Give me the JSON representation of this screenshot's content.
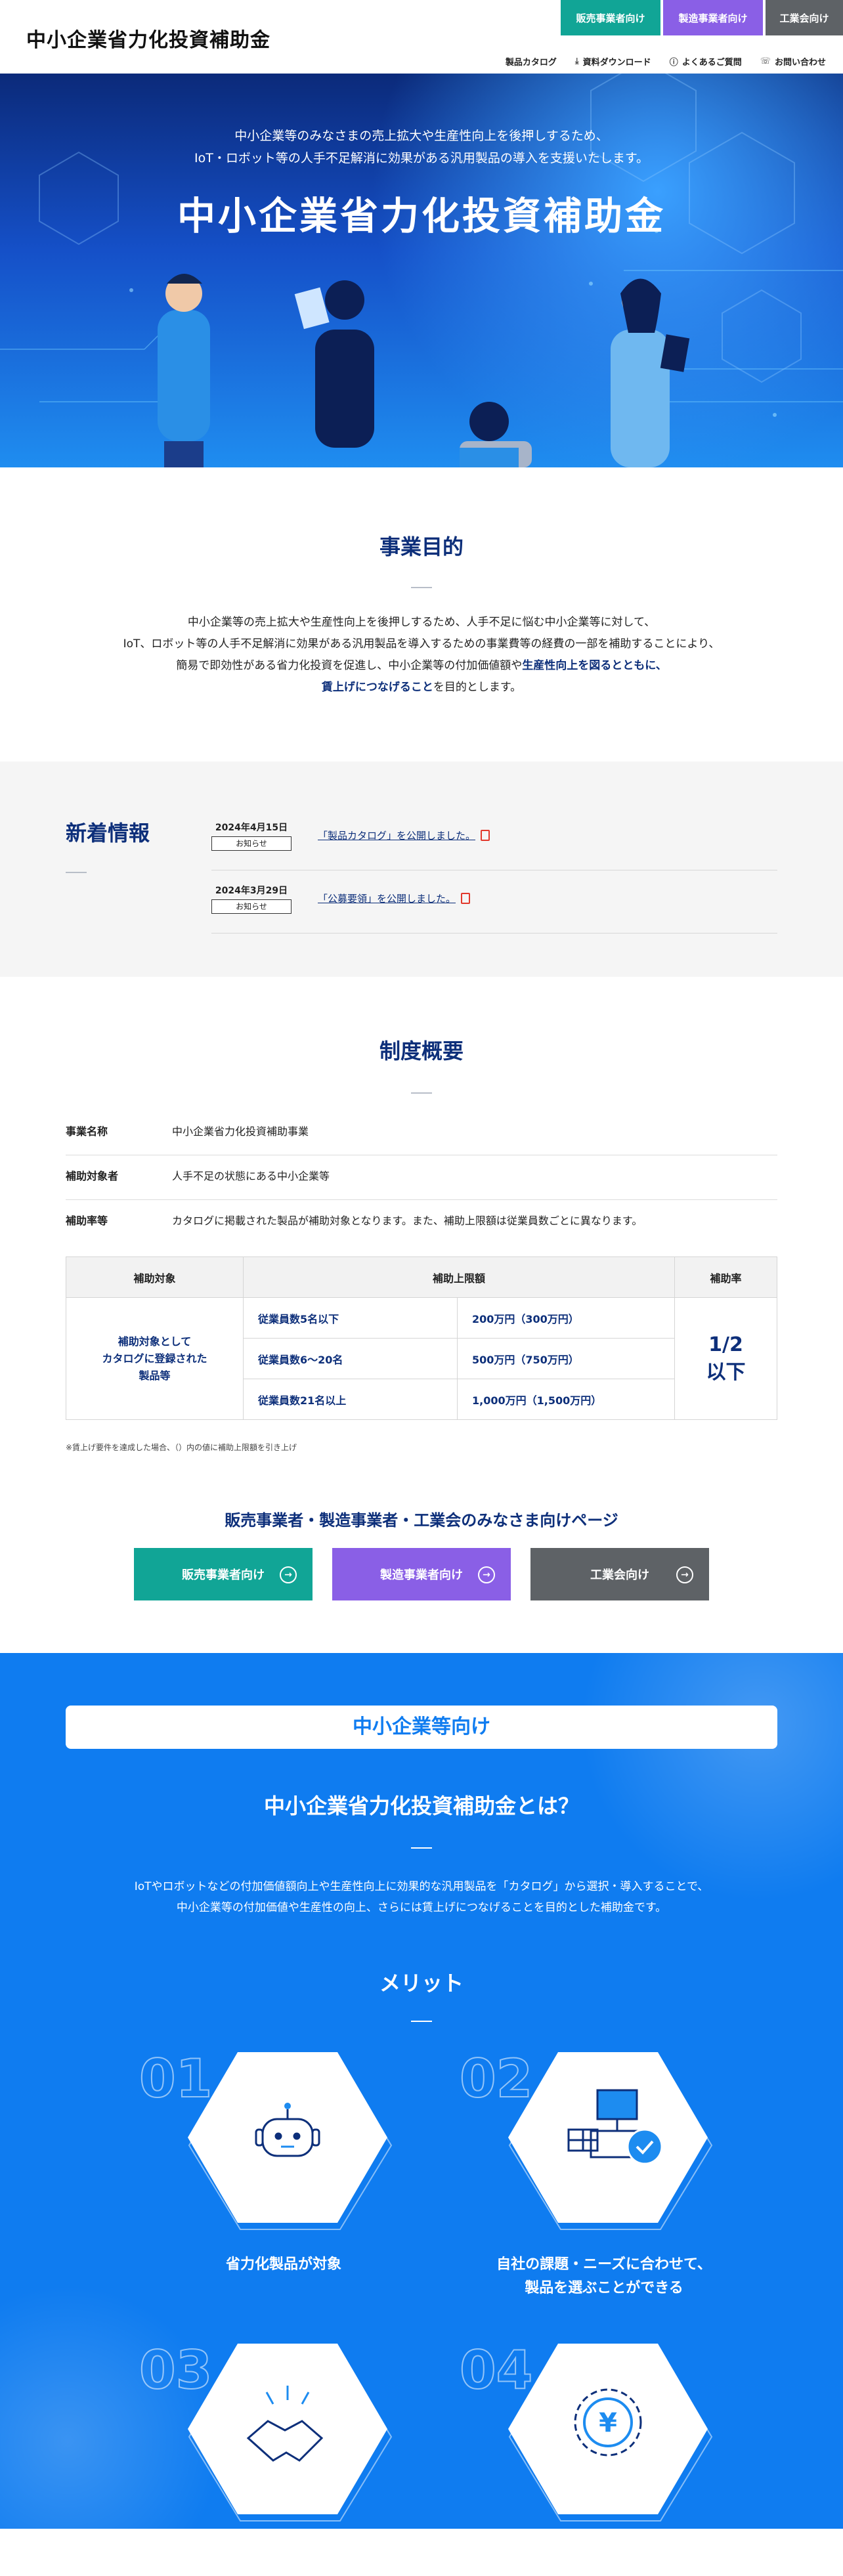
{
  "header": {
    "logo": "中小企業省力化投資補助金",
    "tabs": [
      "販売事業者向け",
      "製造事業者向け",
      "工業会向け"
    ],
    "subnav": [
      "製品カタログ",
      "資料ダウンロード",
      "よくあるご質問",
      "お問い合わせ"
    ]
  },
  "hero": {
    "lead1": "中小企業等のみなさまの売上拡大や生産性向上を後押しするため、",
    "lead2": "IoT・ロボット等の人手不足解消に効果がある汎用製品の導入を支援いたします。",
    "title": "中小企業省力化投資補助金"
  },
  "purpose": {
    "title": "事業目的",
    "line1": "中小企業等の売上拡大や生産性向上を後押しするため、人手不足に悩む中小企業等に対して、",
    "line2": "IoT、ロボット等の人手不足解消に効果がある汎用製品を導入するための事業費等の経費の一部を補助することにより、",
    "line3a": "簡易で即効性がある省力化投資を促進し、中小企業等の付加価値額や",
    "line3b": "生産性向上を図るとともに、",
    "line4a": "賃上げにつなげること",
    "line4b": "を目的とします。"
  },
  "news": {
    "title": "新着情報",
    "items": [
      {
        "date": "2024年4月15日",
        "tag": "お知らせ",
        "text": "「製品カタログ」を公開しました。"
      },
      {
        "date": "2024年3月29日",
        "tag": "お知らせ",
        "text": "「公募要領」を公開しました。"
      }
    ]
  },
  "overview": {
    "title": "制度概要",
    "rows": [
      {
        "k": "事業名称",
        "v": "中小企業省力化投資補助事業"
      },
      {
        "k": "補助対象者",
        "v": "人手不足の状態にある中小企業等"
      },
      {
        "k": "補助率等",
        "v": "カタログに掲載された製品が補助対象となります。また、補助上限額は従業員数ごとに異なります。"
      }
    ],
    "table": {
      "headers": [
        "補助対象",
        "補助上限額",
        "補助率"
      ],
      "target1": "補助対象として",
      "target2": "カタログに登録された",
      "target3": "製品等",
      "rows": [
        {
          "emp": "従業員数5名以下",
          "limit": "200万円（300万円）"
        },
        {
          "emp": "従業員数6〜20名",
          "limit": "500万円（750万円）"
        },
        {
          "emp": "従業員数21名以上",
          "limit": "1,000万円（1,500万円）"
        }
      ],
      "rate1": "1/2",
      "rate2": "以下"
    },
    "note": "※賃上げ要件を達成した場合、（）内の値に補助上限額を引き上げ"
  },
  "pages": {
    "title": "販売事業者・製造事業者・工業会のみなさま向けページ",
    "buttons": [
      "販売事業者向け",
      "製造事業者向け",
      "工業会向け"
    ]
  },
  "sme": {
    "pill": "中小企業等向け",
    "title": "中小企業省力化投資補助金とは？",
    "text1": "IoTやロボットなどの付加価値額向上や生産性向上に効果的な汎用製品を「カタログ」から選択・導入することで、",
    "text2": "中小企業等の付加価値や生産性の向上、さらには賃上げにつなげることを目的とした補助金です。",
    "merit_title": "メリット",
    "merits": [
      {
        "num": "01",
        "line1": "省力化製品が対象",
        "line2": "",
        "icon": "robot-icon"
      },
      {
        "num": "02",
        "line1": "自社の課題・ニーズに合わせて、",
        "line2": "製品を選ぶことができる",
        "icon": "pos-register-icon"
      },
      {
        "num": "03",
        "line1": "",
        "line2": "",
        "icon": "handshake-icon"
      },
      {
        "num": "04",
        "line1": "",
        "line2": "",
        "icon": "yen-icon"
      }
    ]
  },
  "colors": {
    "navy": "#0d2f7a",
    "teal": "#11a596",
    "purple": "#8a5fe6",
    "gray": "#5e6266",
    "blue": "#0f7cf0"
  }
}
